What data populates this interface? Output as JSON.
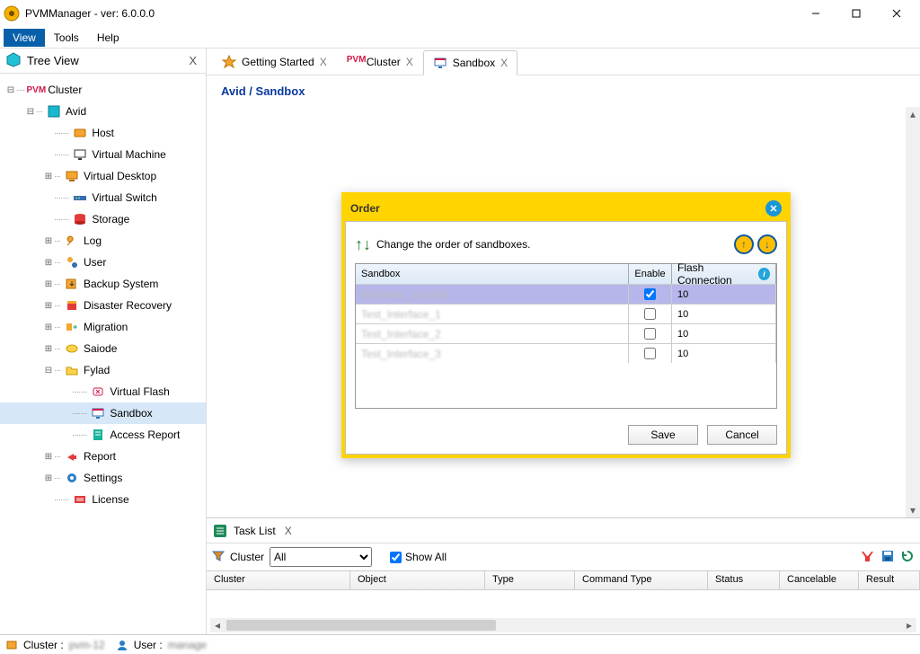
{
  "window": {
    "title": "PVMManager - ver: 6.0.0.0"
  },
  "menu": {
    "view": "View",
    "tools": "Tools",
    "help": "Help"
  },
  "sidebar": {
    "header": "Tree View"
  },
  "tree": {
    "cluster": "Cluster",
    "avid": "Avid",
    "host": "Host",
    "vm": "Virtual Machine",
    "vdesktop": "Virtual Desktop",
    "vswitch": "Virtual Switch",
    "storage": "Storage",
    "log": "Log",
    "user": "User",
    "backup": "Backup System",
    "dr": "Disaster Recovery",
    "migration": "Migration",
    "saiode": "Saiode",
    "fylad": "Fylad",
    "vflash": "Virtual Flash",
    "sandbox": "Sandbox",
    "access": "Access Report",
    "report": "Report",
    "settings": "Settings",
    "license": "License"
  },
  "tabs": {
    "t0": "Getting Started",
    "t1": "Cluster",
    "t2": "Sandbox"
  },
  "breadcrumb": "Avid / Sandbox",
  "dialog": {
    "title": "Order",
    "instruction": "Change the order of sandboxes.",
    "headers": {
      "sandbox": "Sandbox",
      "enable": "Enable",
      "flash": "Flash Connection"
    },
    "rows": [
      {
        "name": "Windows_Security",
        "enabled": true,
        "flash": "10",
        "selected": true
      },
      {
        "name": "Test_Interface_1",
        "enabled": false,
        "flash": "10",
        "selected": false
      },
      {
        "name": "Test_Interface_2",
        "enabled": false,
        "flash": "10",
        "selected": false
      },
      {
        "name": "Test_Interface_3",
        "enabled": false,
        "flash": "10",
        "selected": false
      }
    ],
    "save": "Save",
    "cancel": "Cancel"
  },
  "tasks": {
    "header": "Task List",
    "filterLabel": "Cluster",
    "filterValue": "All",
    "showAll": "Show All",
    "cols": {
      "cluster": "Cluster",
      "object": "Object",
      "type": "Type",
      "command": "Command Type",
      "status": "Status",
      "cancelable": "Cancelable",
      "result": "Result"
    }
  },
  "status": {
    "clusterLabel": "Cluster :",
    "clusterVal": "pvm-12",
    "userLabel": "User :",
    "userVal": "manage"
  }
}
